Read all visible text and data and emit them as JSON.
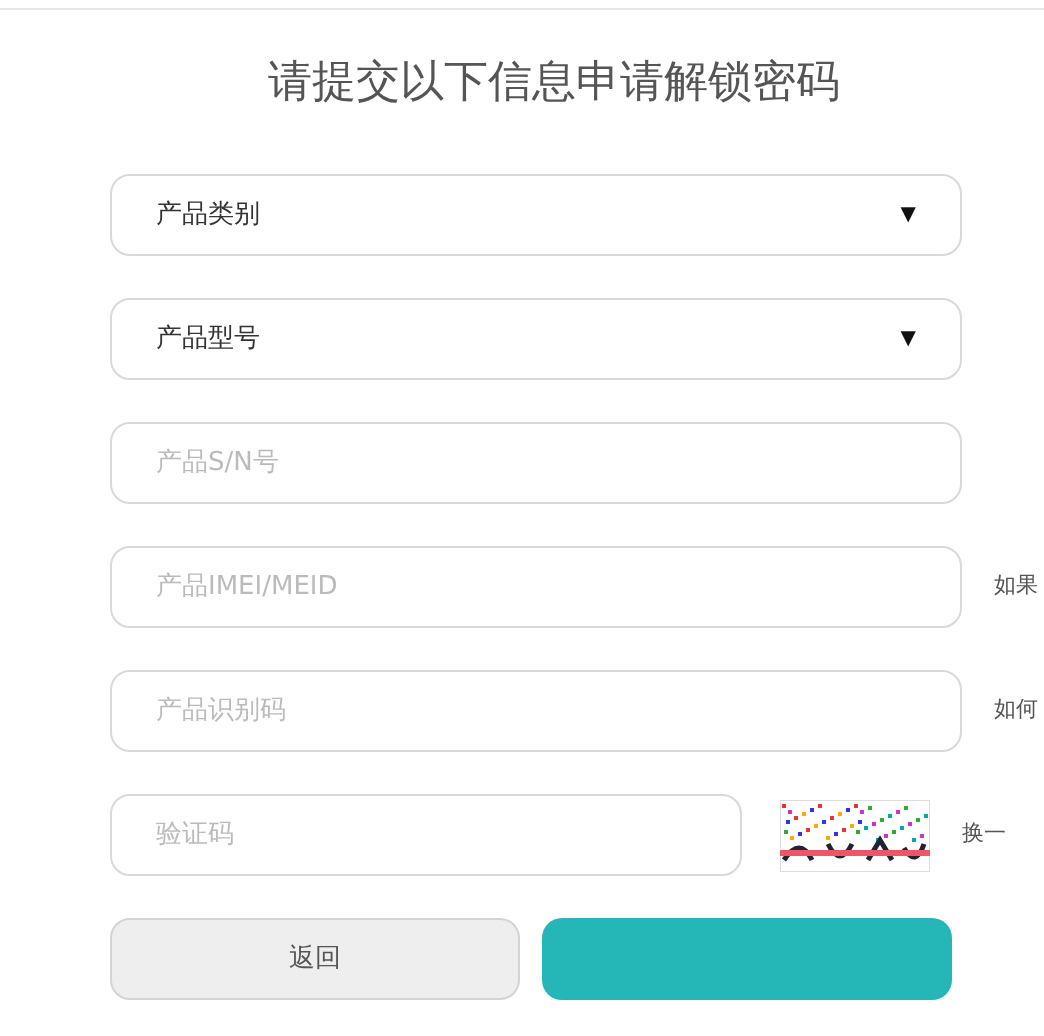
{
  "title": "请提交以下信息申请解锁密码",
  "fields": [
    {
      "kind": "select",
      "value": "产品类别",
      "caret": "▼"
    },
    {
      "kind": "select",
      "value": "产品型号",
      "caret": "▼"
    },
    {
      "kind": "input",
      "placeholder": "产品S/N号"
    },
    {
      "kind": "input",
      "placeholder": "产品IMEI/MEID",
      "note": "如果"
    },
    {
      "kind": "input",
      "placeholder": "产品识别码",
      "note": "如何"
    },
    {
      "kind": "captcha",
      "placeholder": "验证码",
      "note": "换一"
    }
  ],
  "buttons": [
    {
      "kind": "secondary",
      "label": "返回"
    },
    {
      "kind": "primary"
    }
  ]
}
